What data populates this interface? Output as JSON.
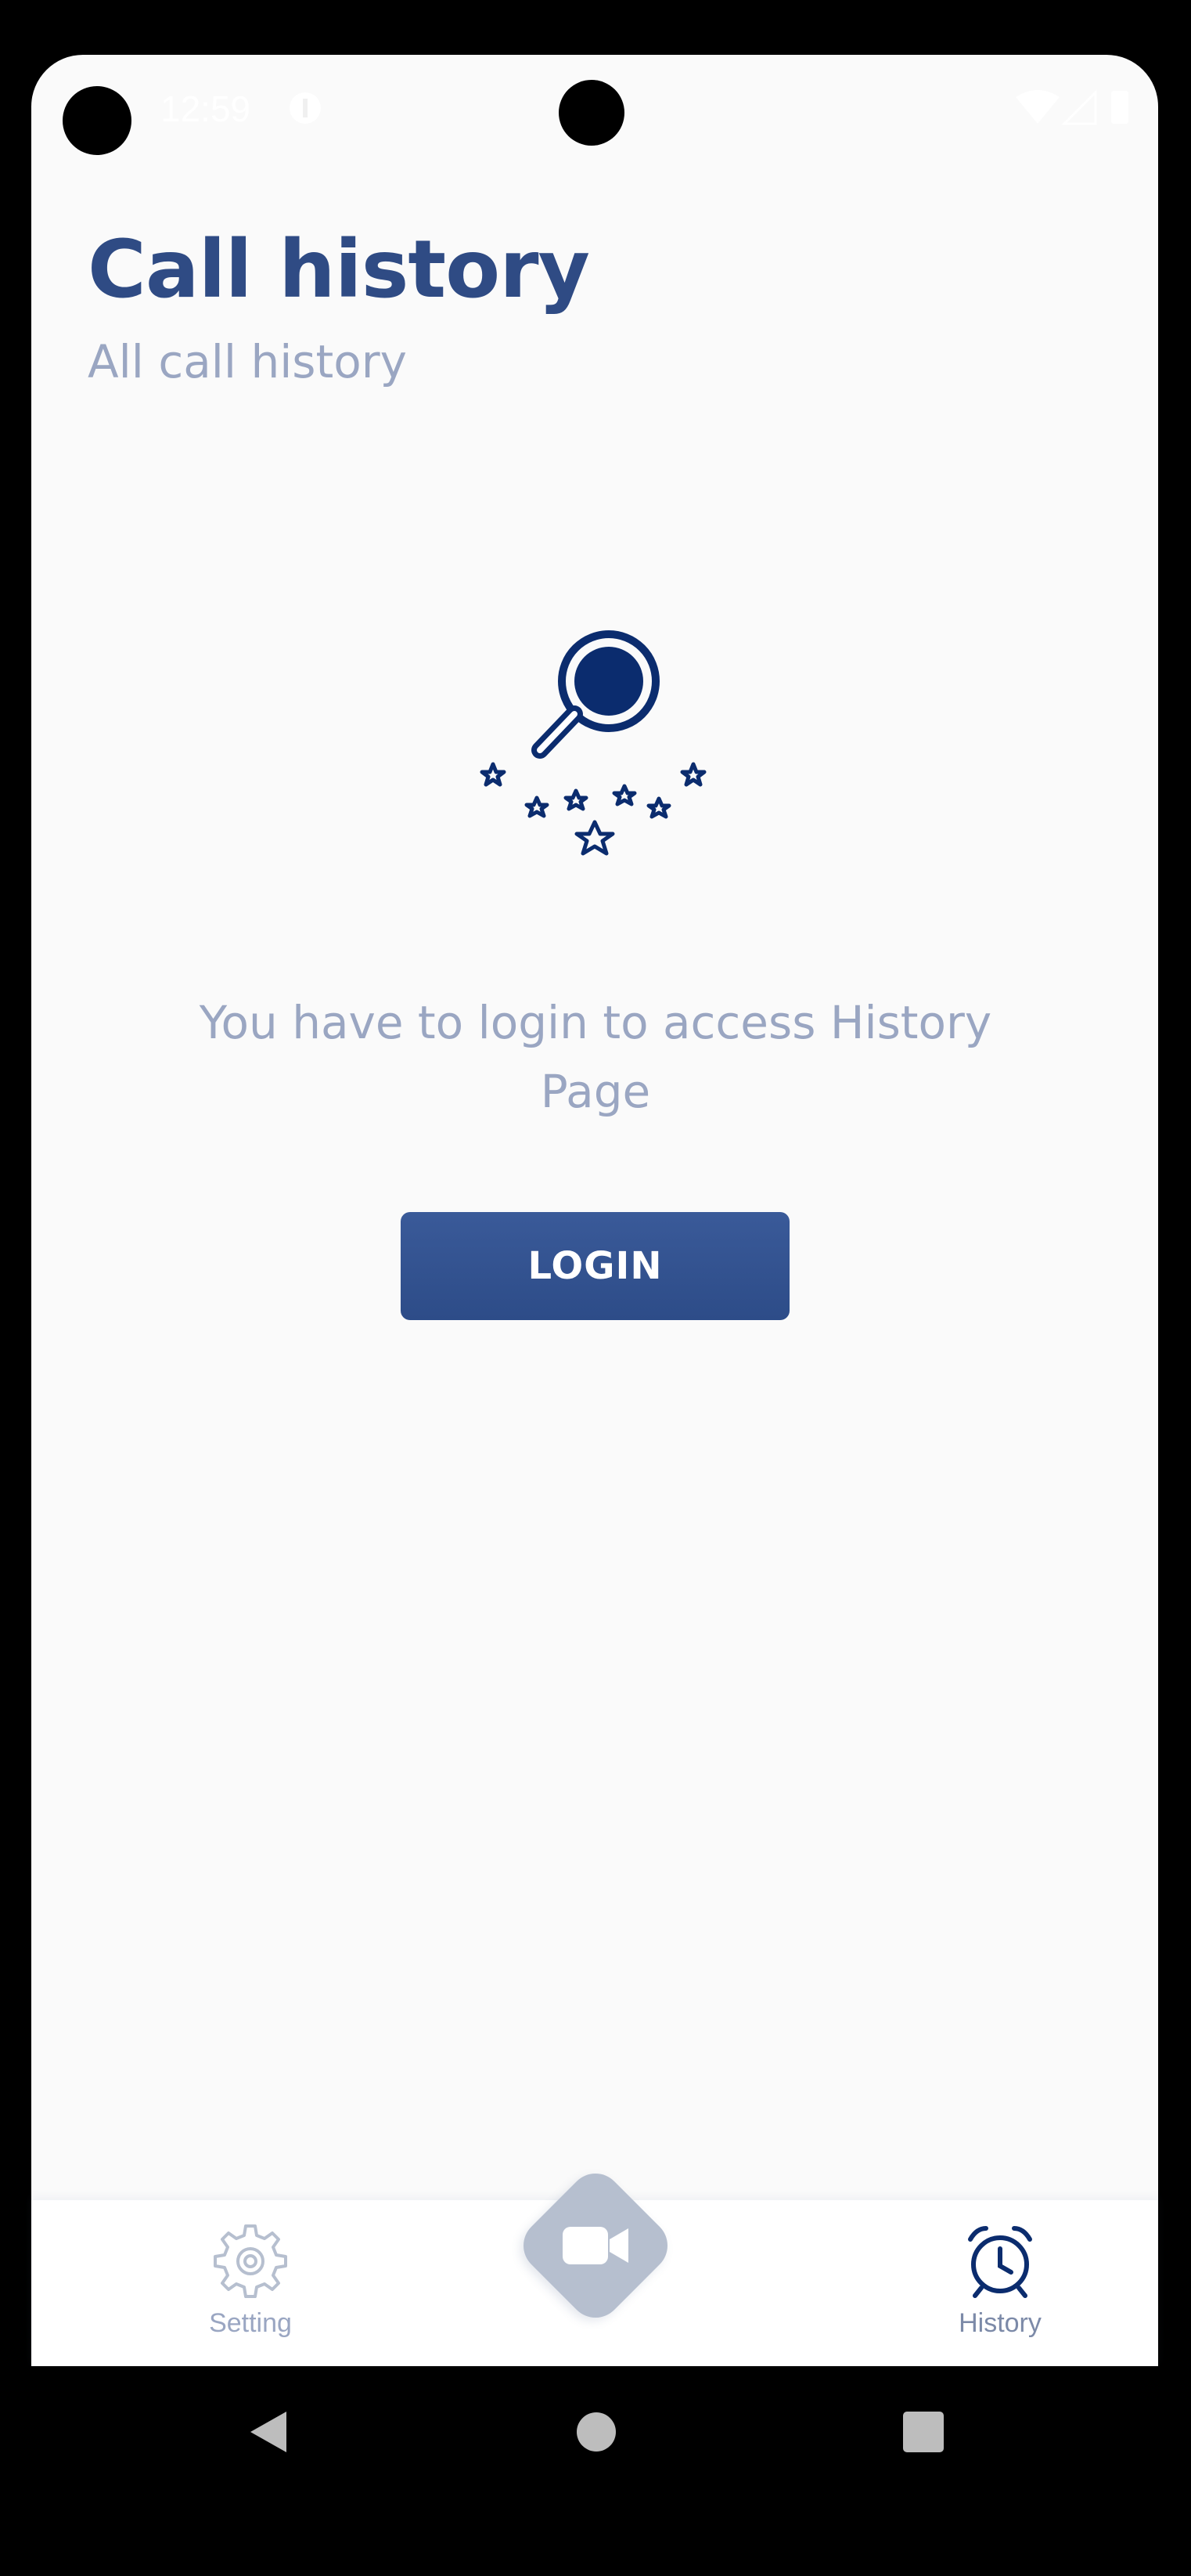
{
  "status_bar": {
    "time": "12:59",
    "notification_icon": "app-notification-icon",
    "right_icons": [
      "wifi-icon",
      "signal-icon",
      "battery-icon"
    ]
  },
  "header": {
    "title": "Call history",
    "subtitle": "All call history"
  },
  "empty_state": {
    "illustration": "magnifier-stars-icon",
    "message": "You have to login to access History Page",
    "button_label": "LOGIN"
  },
  "bottom_nav": {
    "items": [
      {
        "label": "Setting",
        "icon": "gear-icon",
        "active": false
      },
      {
        "label": "History",
        "icon": "alarm-clock-icon",
        "active": true
      }
    ],
    "center_action_icon": "video-camera-icon"
  },
  "system_nav": [
    "back-icon",
    "home-icon",
    "recents-icon"
  ],
  "colors": {
    "accent": "#2f4b84",
    "muted_text": "#9aa6c2",
    "button_bg": "#34528f",
    "icon_dark": "#0b2c6e",
    "background": "#fafafa"
  }
}
